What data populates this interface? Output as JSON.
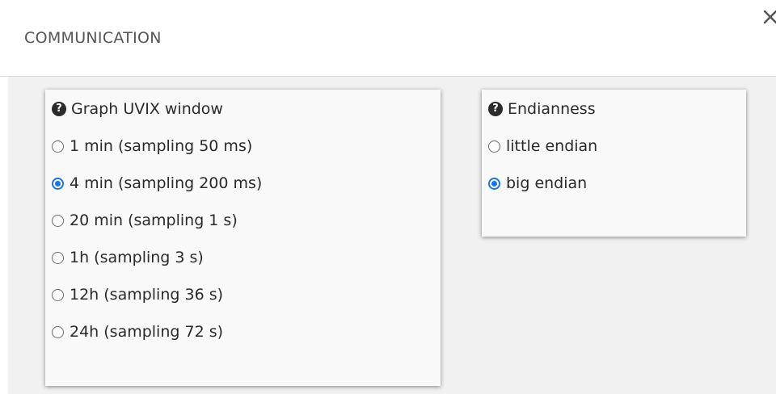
{
  "header": {
    "title": "COMMUNICATION",
    "close_icon": "close-icon"
  },
  "window_group": {
    "heading": "Graph UVIX window",
    "help_icon": "question-circle-icon",
    "options": [
      {
        "label": "1 min (sampling 50 ms)",
        "checked": false
      },
      {
        "label": "4 min (sampling 200 ms)",
        "checked": true
      },
      {
        "label": "20 min (sampling 1 s)",
        "checked": false
      },
      {
        "label": "1h (sampling 3 s)",
        "checked": false
      },
      {
        "label": "12h (sampling 36 s)",
        "checked": false
      },
      {
        "label": "24h (sampling 72 s)",
        "checked": false
      }
    ]
  },
  "endian_group": {
    "heading": "Endianness",
    "help_icon": "question-circle-icon",
    "options": [
      {
        "label": "little endian",
        "checked": false
      },
      {
        "label": "big endian",
        "checked": true
      }
    ]
  },
  "colors": {
    "accent": "#1a73e8",
    "panel_background": "#f9f9f9",
    "content_background": "#f1f1f1",
    "header_text": "#555555"
  }
}
